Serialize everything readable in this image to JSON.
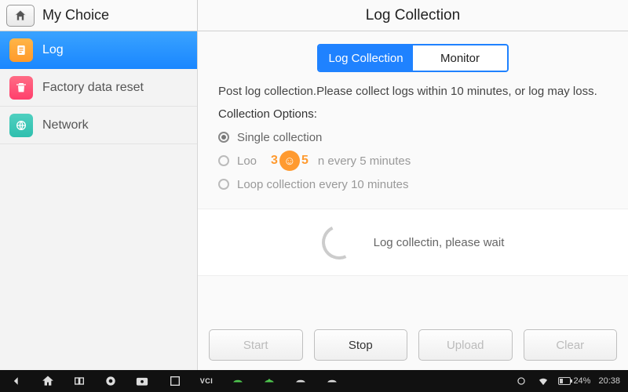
{
  "header": {
    "left_title": "My Choice",
    "right_title": "Log Collection"
  },
  "sidebar": {
    "items": [
      {
        "label": "Log",
        "icon": "log",
        "active": true
      },
      {
        "label": "Factory data reset",
        "icon": "reset",
        "active": false
      },
      {
        "label": "Network",
        "icon": "network",
        "active": false
      }
    ]
  },
  "segmented": {
    "options": [
      "Log Collection",
      "Monitor"
    ],
    "selected": 0
  },
  "description": "Post log collection.Please collect logs within 10 minutes, or log may loss.",
  "collection": {
    "title": "Collection Options:",
    "options": [
      "Single collection",
      "Loop collection every 5 minutes",
      "Loop collection every 10 minutes"
    ],
    "selected": 0
  },
  "watermark": {
    "left": "3",
    "right": "5"
  },
  "status": "Log collectin, please wait",
  "actions": {
    "start": {
      "label": "Start",
      "enabled": false
    },
    "stop": {
      "label": "Stop",
      "enabled": true
    },
    "upload": {
      "label": "Upload",
      "enabled": false
    },
    "clear": {
      "label": "Clear",
      "enabled": false
    }
  },
  "osbar": {
    "battery_pct": "24%",
    "clock": "20:38",
    "signal_icon": "▲"
  }
}
